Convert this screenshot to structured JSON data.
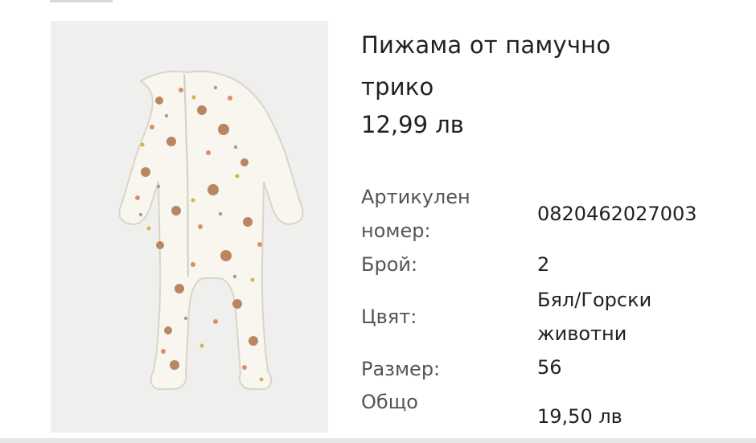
{
  "product": {
    "image_alt": "pajama-onesie-image",
    "title_line1": "Пижама от памучно",
    "title_line2": "трико",
    "price": "12,99 лв"
  },
  "details": {
    "article_label_line1": "Артикулен",
    "article_label_line2": "номер:",
    "article_value": "0820462027003",
    "quantity_label": "Брой:",
    "quantity_value": "2",
    "color_label": "Цвят:",
    "color_value_line1": "Бял/Горски",
    "color_value_line2": "животни",
    "size_label": "Размер:",
    "size_value": "56",
    "total_label": "Общо",
    "total_value": "19,50 лв"
  }
}
